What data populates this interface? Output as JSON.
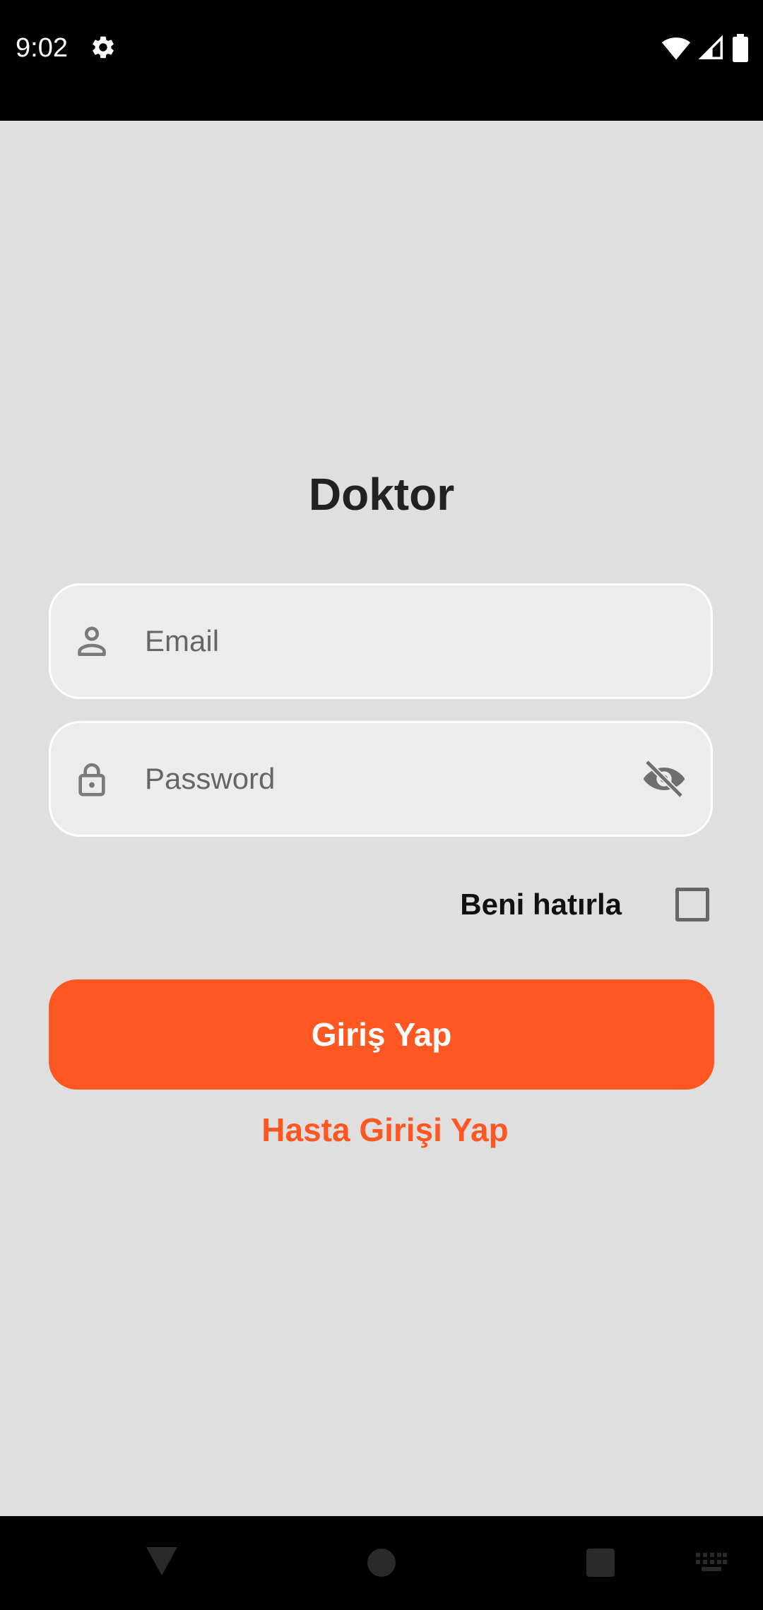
{
  "status_bar": {
    "time": "9:02"
  },
  "login": {
    "title": "Doktor",
    "email_placeholder": "Email",
    "password_placeholder": "Password",
    "remember_label": "Beni hatırla",
    "remember_checked": false,
    "login_button_label": "Giriş Yap",
    "patient_login_link": "Hasta Girişi Yap"
  },
  "icons": {
    "status_settings": "gear-icon",
    "status_wifi": "wifi-icon",
    "status_signal": "signal-icon",
    "status_battery": "battery-icon",
    "email_field": "person-icon",
    "password_field": "lock-icon",
    "password_toggle": "eye-off-icon",
    "nav_back": "back-triangle-icon",
    "nav_home": "home-circle-icon",
    "nav_recents": "recents-square-icon",
    "nav_keyboard": "keyboard-icon"
  },
  "colors": {
    "accent": "#ff5722",
    "background": "#dfdfdf",
    "field_background": "#ececec",
    "system_bars": "#000000"
  }
}
